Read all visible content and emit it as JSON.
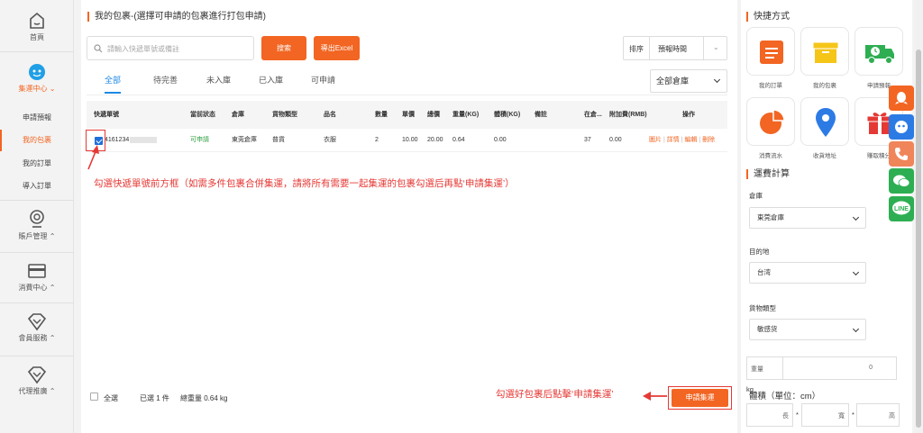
{
  "sidebar": {
    "home_label": "首頁",
    "consolidation_label": "集運中心",
    "sub_items": [
      "申請預報",
      "我的包裹",
      "我的訂單",
      "導入訂單"
    ],
    "account_label": "賬戶管理",
    "spending_label": "消費中心",
    "member_label": "會員服務",
    "agent_label": "代理推廣"
  },
  "main": {
    "title": "我的包裹-(選擇可申請的包裹進行打包申請)",
    "search_placeholder": "請輸入快遞單號或備註",
    "search_button": "搜索",
    "export_button": "導出Excel",
    "sort_label": "排序",
    "sort_value": "預報時間",
    "tabs": [
      "全部",
      "待完善",
      "未入庫",
      "已入庫",
      "可申請"
    ],
    "warehouse_filter": "全部倉庫",
    "columns": [
      "快遞單號",
      "當前狀态",
      "倉庫",
      "貨物類型",
      "品名",
      "數量",
      "單價",
      "總價",
      "重量(KG)",
      "體積(KG)",
      "備註",
      "在倉...",
      "附加費(RMB)",
      "操作"
    ],
    "row": {
      "tracking": "4161234",
      "status": "可申請",
      "warehouse": "東莞倉庫",
      "goods_type": "普貨",
      "name": "衣服",
      "qty": "2",
      "unit_price": "10.00",
      "total": "20.00",
      "weight": "0.64",
      "volume": "0.00",
      "remark": "",
      "days": "37",
      "surcharge": "0.00",
      "actions": [
        "圖片",
        "詳情",
        "編輯",
        "刪除"
      ]
    },
    "annotation_select": "勾選快遞單號前方框（如需多件包裹合併集運，請將所有需要一起集運的包裹勾選后再點‘申請集運’）",
    "annotation_apply": "勾選好包裹后點擊‘申請集運’",
    "select_all": "全選",
    "selected_count": "已選 1 件",
    "total_weight": "總重量 0.64 kg",
    "apply_button": "申請集運"
  },
  "right": {
    "shortcuts_title": "快捷方式",
    "shortcuts": [
      "我的訂單",
      "我的包裹",
      "申請預報",
      "消費流水",
      "收貨地址",
      "賺取積分"
    ],
    "calc_title": "運費計算",
    "warehouse_label": "倉庫",
    "warehouse_value": "東莞倉庫",
    "destination_label": "目的地",
    "destination_value": "台湾",
    "goods_label": "貨物類型",
    "goods_value": "敏感货",
    "weight_label": "重量",
    "weight_value": "0",
    "weight_unit": "kg",
    "volume_label": "體積（單位：cm）",
    "length_label": "長",
    "width_label": "寬",
    "height_label": "高",
    "times_sign": "*"
  },
  "colors": {
    "accent": "#f26522",
    "link_blue": "#1e88e5",
    "annotation_red": "#e53935",
    "status_green": "#2e9e3e"
  },
  "icons": {
    "qq": "qq-icon",
    "chat_bot": "chatbot-icon",
    "phone": "phone-icon",
    "wechat": "wechat-icon",
    "line": "line-icon"
  }
}
